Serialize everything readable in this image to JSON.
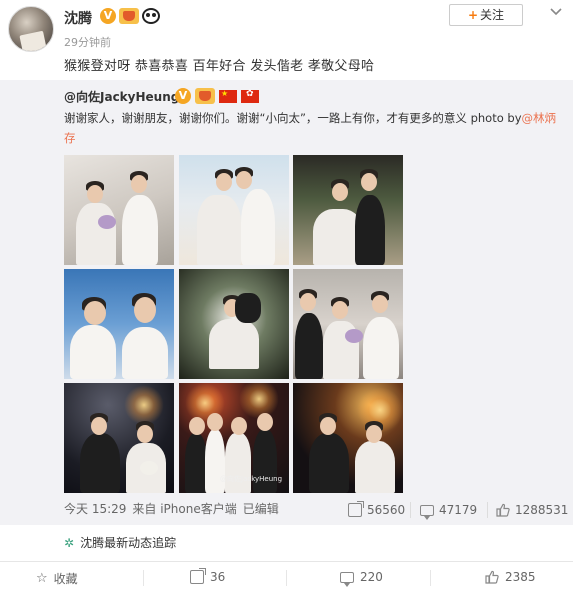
{
  "post": {
    "author": "沈腾",
    "time": "29分钟前",
    "follow_label": "关注",
    "text": "猴猴登对呀 恭喜恭喜 百年好合 发头偕老 孝敬父母哈"
  },
  "repost": {
    "author": "@向佐JackyHeung",
    "text_main": "谢谢家人，谢谢朋友，谢谢你们。谢谢“小向太”，一路上有你，才有更多的意义 photo by",
    "text_mention": "@林炳存",
    "photo_watermark": "@向佐JackyHeung",
    "meta": {
      "time": "今天 15:29",
      "source": "来自 iPhone客户端",
      "edited": "已编辑"
    },
    "stats": {
      "reposts": "56560",
      "comments": "47179",
      "likes": "1288531"
    }
  },
  "tracker_label": "沈腾最新动态追踪",
  "actions": {
    "favorite": "收藏",
    "reposts": "36",
    "comments": "220",
    "likes": "2385"
  },
  "colors": {
    "accent": "#f77b0f",
    "mention": "#eb7350",
    "repost_bg": "#f2f2f5"
  },
  "icons": [
    "more-icon",
    "verified-icon",
    "vip-icon",
    "panda-icon",
    "china-flag-icon",
    "hk-flag-icon",
    "repost-icon",
    "comment-icon",
    "like-icon",
    "star-icon",
    "tracker-icon"
  ]
}
